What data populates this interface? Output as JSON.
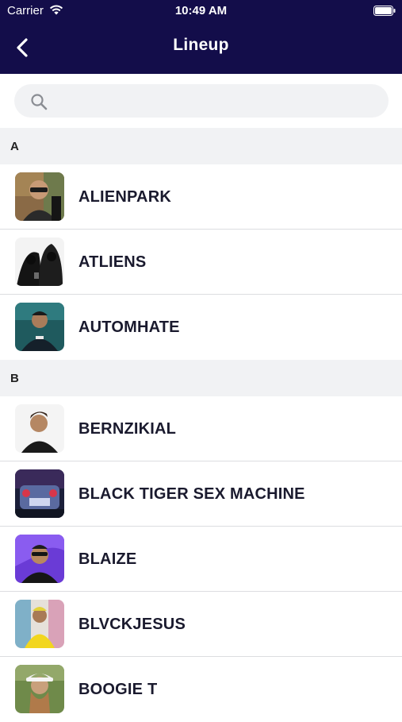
{
  "status": {
    "carrier": "Carrier",
    "time": "10:49 AM"
  },
  "header": {
    "title": "Lineup"
  },
  "search": {
    "placeholder": ""
  },
  "sections": [
    {
      "letter": "A",
      "items": [
        {
          "name": "ALIENPARK"
        },
        {
          "name": "ATLIENS"
        },
        {
          "name": "AUTOMHATE"
        }
      ]
    },
    {
      "letter": "B",
      "items": [
        {
          "name": "BERNZIKIAL"
        },
        {
          "name": "BLACK TIGER SEX MACHINE"
        },
        {
          "name": "BLAIZE"
        },
        {
          "name": "BLVCKJESUS"
        },
        {
          "name": "BOOGIE T"
        }
      ]
    }
  ],
  "colors": {
    "header_bg": "#130d4a",
    "section_bg": "#f1f2f4",
    "label": "#1a1a2e"
  }
}
